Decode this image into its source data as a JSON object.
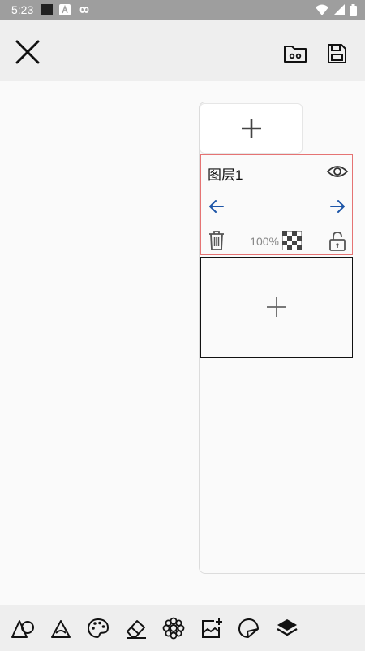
{
  "status_bar": {
    "time": "5:23",
    "icons": [
      "square-notification-icon",
      "a-notification-icon",
      "infinity-icon",
      "wifi-icon",
      "signal-icon",
      "battery-icon"
    ]
  },
  "app_bar": {
    "icons": [
      "close-icon",
      "folder-icon",
      "save-icon"
    ]
  },
  "layer_panel": {
    "add_icon": "plus-icon",
    "layers": [
      {
        "name": "图层1",
        "opacity": "100%",
        "icons": [
          "eye-icon",
          "arrow-left-icon",
          "arrow-right-icon",
          "trash-icon",
          "checkerboard-icon",
          "unlock-icon"
        ]
      }
    ]
  },
  "bottom_toolbar": {
    "tools": [
      "shapes-icon",
      "blend-icon",
      "palette-icon",
      "eraser-icon",
      "brush-settings-icon",
      "add-image-icon",
      "sticker-icon",
      "layers-icon"
    ]
  },
  "colors": {
    "status_bar": "#9e9e9e",
    "app_bar": "#eeeeee",
    "canvas": "#fafafa",
    "selected_layer_border": "#e57373",
    "arrow_blue": "#1e56a8"
  }
}
